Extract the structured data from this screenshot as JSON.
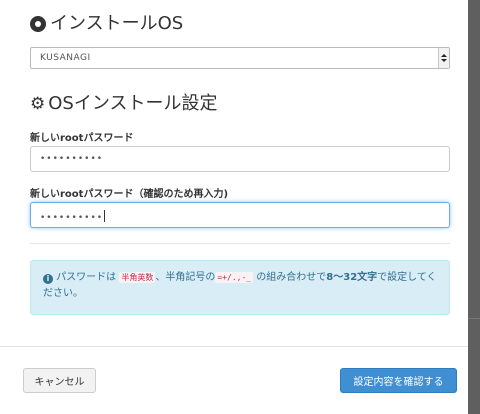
{
  "install_os": {
    "title": "インストールOS",
    "select_value": "KUSANAGI"
  },
  "os_settings": {
    "title": "OSインストール設定",
    "password_label": "新しいrootパスワード",
    "password_value": "••••••••••",
    "confirm_label": "新しいrootパスワード（確認のため再入力)",
    "confirm_value": "••••••••••"
  },
  "alert": {
    "text_1": "パスワードは",
    "code_1": "半角英数",
    "text_2": "、半角記号の",
    "code_2": "=+/.,-_",
    "text_3": "の組み合わせで",
    "bold": "8〜32文字",
    "text_4": "で設定してください。"
  },
  "footer": {
    "cancel_label": "キャンセル",
    "confirm_label": "設定内容を確認する"
  },
  "colors": {
    "primary": "#3f8fd2",
    "alert_bg": "#d9edf7",
    "alert_text": "#31708f",
    "code_text": "#c7254e"
  }
}
